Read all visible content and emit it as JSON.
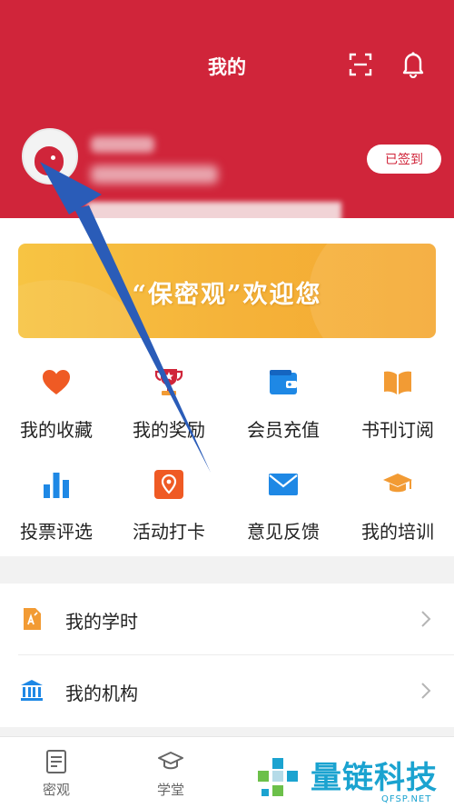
{
  "header": {
    "title": "我的"
  },
  "profile": {
    "signed_label": "已签到"
  },
  "banner": {
    "text": "“保密观”欢迎您"
  },
  "grid": [
    {
      "label": "我的收藏",
      "icon": "heart-icon"
    },
    {
      "label": "我的奖励",
      "icon": "trophy-icon"
    },
    {
      "label": "会员充值",
      "icon": "wallet-icon"
    },
    {
      "label": "书刊订阅",
      "icon": "book-icon"
    },
    {
      "label": "投票评选",
      "icon": "bar-chart-icon"
    },
    {
      "label": "活动打卡",
      "icon": "location-pin-icon"
    },
    {
      "label": "意见反馈",
      "icon": "mail-icon"
    },
    {
      "label": "我的培训",
      "icon": "graduation-cap-icon"
    }
  ],
  "list": [
    {
      "label": "我的学时",
      "icon": "study-hours-icon"
    },
    {
      "label": "我的机构",
      "icon": "institution-icon"
    }
  ],
  "tabs": [
    {
      "label": "密观",
      "icon": "document-icon"
    },
    {
      "label": "学堂",
      "icon": "graduation-cap-icon"
    }
  ],
  "watermark": {
    "title": "量链科技",
    "sub": "QFSP.NET"
  },
  "colors": {
    "brand_red": "#d0253a",
    "banner_orange": "#f5b33a",
    "icon_blue": "#1e88e5",
    "icon_orange": "#f29b34"
  }
}
